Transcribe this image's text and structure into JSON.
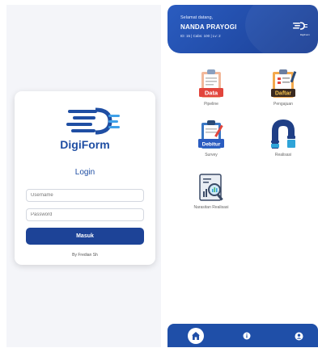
{
  "login": {
    "brand": "DigiForm",
    "title": "Login",
    "username_placeholder": "Username",
    "password_placeholder": "Password",
    "submit_label": "Masuk",
    "credit": "By Fredian Sh"
  },
  "dashboard": {
    "greeting": "Selamat datang,",
    "user_name": "NANDA PRAYOGI",
    "user_meta": "ID: 15 | Cabs: 100 | Lv: 2",
    "header_logo_text": "DigiForm",
    "menu": [
      {
        "label": "Pipeline",
        "icon": "data-clipboard-icon",
        "icon_text": "Data"
      },
      {
        "label": "Pengajuan",
        "icon": "daftar-clipboard-icon",
        "icon_text": "Daftar"
      },
      {
        "label": "Survey",
        "icon": "debitur-clipboard-icon",
        "icon_text": "Debitur"
      },
      {
        "label": "Realisasi",
        "icon": "pipe-icon",
        "icon_text": ""
      },
      {
        "label": "Narasitan Realisasi",
        "icon": "chart-search-icon",
        "icon_text": ""
      }
    ],
    "nav": [
      {
        "name": "home-icon"
      },
      {
        "name": "info-icon"
      },
      {
        "name": "profile-icon"
      }
    ]
  },
  "colors": {
    "primary": "#1f4ea3",
    "header": "#2a5cc0",
    "nav": "#1f4fa8",
    "login_bg": "#f4f5f9"
  }
}
